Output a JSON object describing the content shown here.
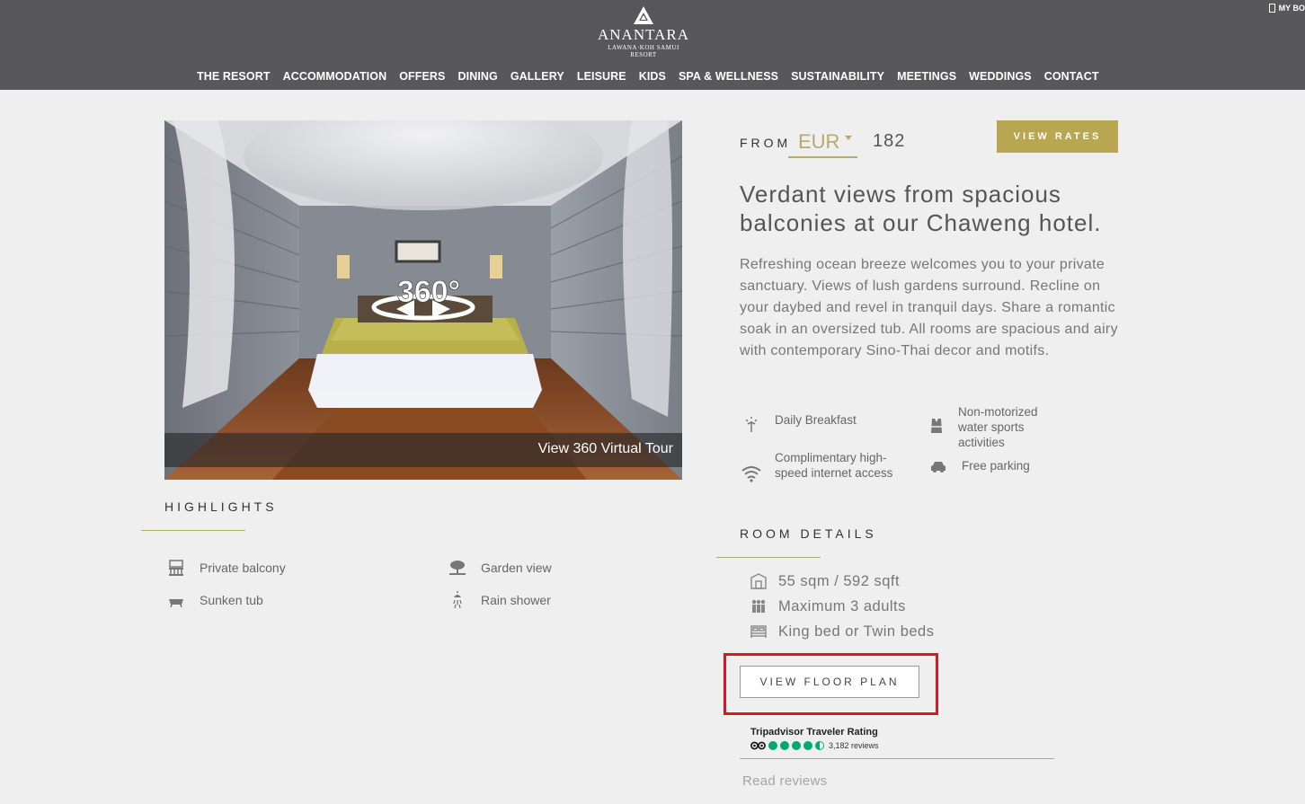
{
  "header": {
    "brand": "ANANTARA",
    "brand_sub1": "LAWANA·KOH SAMUI",
    "brand_sub2": "RESORT",
    "my_booking": "MY BO",
    "nav": [
      "THE RESORT",
      "ACCOMMODATION",
      "OFFERS",
      "DINING",
      "GALLERY",
      "LEISURE",
      "KIDS",
      "SPA & WELLNESS",
      "SUSTAINABILITY",
      "MEETINGS",
      "WEDDINGS",
      "CONTACT"
    ]
  },
  "gallery": {
    "badge": "360°",
    "tour_label": "View 360 Virtual Tour"
  },
  "highlights": {
    "title": "HIGHLIGHTS",
    "items": [
      {
        "label": "Private balcony",
        "icon": "balcony-icon"
      },
      {
        "label": "Garden view",
        "icon": "garden-view-icon"
      },
      {
        "label": "Sunken tub",
        "icon": "bathtub-icon"
      },
      {
        "label": "Rain shower",
        "icon": "shower-icon"
      }
    ]
  },
  "pricing": {
    "from_label": "FROM",
    "currency": "EUR",
    "price": "182",
    "view_rates": "VIEW RATES"
  },
  "room": {
    "headline": "Verdant views from spacious balconies at our Chaweng hotel.",
    "description": "Refreshing ocean breeze welcomes you to your private sanctuary. Views of lush gardens surround. Recline on your daybed and revel in tranquil days. Share a romantic soak in an oversized tub. All rooms are spacious and airy with contemporary Sino-Thai decor and motifs."
  },
  "amenities": [
    {
      "label": "Daily Breakfast",
      "icon": "breakfast-icon"
    },
    {
      "label": "Non-motorized water sports activities",
      "icon": "life-vest-icon"
    },
    {
      "label": "Complimentary high-speed internet access",
      "icon": "wifi-icon"
    },
    {
      "label": "Free parking",
      "icon": "car-icon"
    }
  ],
  "room_details": {
    "title": "ROOM DETAILS",
    "size": "55 sqm / 592 sqft",
    "occupancy": "Maximum 3 adults",
    "beds": "King bed or Twin beds",
    "floor_plan_button": "VIEW FLOOR PLAN"
  },
  "tripadvisor": {
    "title": "Tripadvisor Traveler Rating",
    "rating": 4.5,
    "reviews": "3,182 reviews",
    "read_reviews": "Read reviews"
  },
  "colors": {
    "header_bg": "#58585a",
    "accent_gold": "#b9a650",
    "highlight_red": "#e0141e",
    "tripadvisor_green": "#00aa6c"
  }
}
